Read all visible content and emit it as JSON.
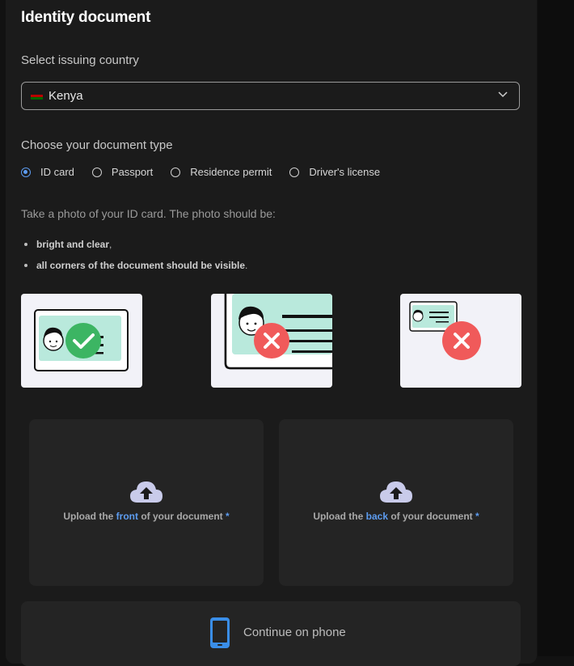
{
  "title": "Identity document",
  "country": {
    "label": "Select issuing country",
    "value": "Kenya",
    "flag_colors": [
      "#1a1a1a",
      "#ffffff",
      "#bb0000",
      "#ffffff",
      "#006600"
    ]
  },
  "doc_type": {
    "label": "Choose your document type",
    "options": [
      {
        "label": "ID card",
        "selected": true
      },
      {
        "label": "Passport",
        "selected": false
      },
      {
        "label": "Residence permit",
        "selected": false
      },
      {
        "label": "Driver's license",
        "selected": false
      }
    ]
  },
  "instructions": {
    "text": "Take a photo of your ID card. The photo should be:",
    "bullets": [
      {
        "bold": "bright and clear",
        "rest": ","
      },
      {
        "bold": "all corners of the document should be visible",
        "rest": "."
      }
    ]
  },
  "examples": [
    {
      "name": "good-example",
      "status": "correct"
    },
    {
      "name": "cropped-example",
      "status": "wrong"
    },
    {
      "name": "too-far-example",
      "status": "wrong"
    }
  ],
  "upload_front": {
    "prefix": "Upload the ",
    "highlight": "front",
    "suffix": " of your document ",
    "required": "*"
  },
  "upload_back": {
    "prefix": "Upload the ",
    "highlight": "back",
    "suffix": " of your document ",
    "required": "*"
  },
  "phone": {
    "label": "Continue on phone"
  },
  "colors": {
    "accent": "#5d9cf0",
    "success": "#3cb563",
    "error": "#f05a5a",
    "card_mint": "#b9e9dc"
  }
}
